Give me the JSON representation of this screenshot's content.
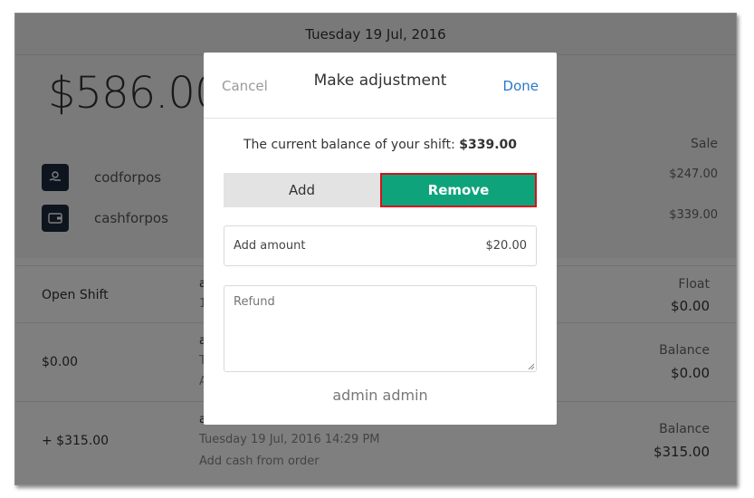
{
  "header": {
    "date": "Tuesday 19 Jul, 2016"
  },
  "summary": {
    "total": "$586.00",
    "sale_label": "Sale"
  },
  "methods": [
    {
      "name": "codforpos",
      "amount": "$247.00",
      "icon": "hand-coin-icon"
    },
    {
      "name": "cashforpos",
      "amount": "$339.00",
      "icon": "wallet-icon"
    }
  ],
  "history": [
    {
      "left": "Open Shift",
      "mid_top": "a",
      "mid_line2": "1",
      "right_label": "Float",
      "right_value": "$0.00"
    },
    {
      "left": "$0.00",
      "mid_top": "a",
      "mid_line2": "T",
      "mid_line3": "A",
      "right_label": "Balance",
      "right_value": "$0.00"
    },
    {
      "left": "+ $315.00",
      "mid_top": "a",
      "mid_line2": "Tuesday 19 Jul, 2016 14:29 PM",
      "mid_line3": "Add cash from order",
      "right_label": "Balance",
      "right_value": "$315.00"
    }
  ],
  "modal": {
    "cancel": "Cancel",
    "title": "Make adjustment",
    "done": "Done",
    "balance_prefix": "The current balance of your shift: ",
    "balance_value": "$339.00",
    "add_label": "Add",
    "remove_label": "Remove",
    "amount_label": "Add amount",
    "amount_value": "$20.00",
    "refund_placeholder": "Refund",
    "user": "admin admin"
  },
  "colors": {
    "remove_bg": "#0fa37c",
    "remove_border": "#d7101a",
    "done_link": "#2a7ac8"
  }
}
